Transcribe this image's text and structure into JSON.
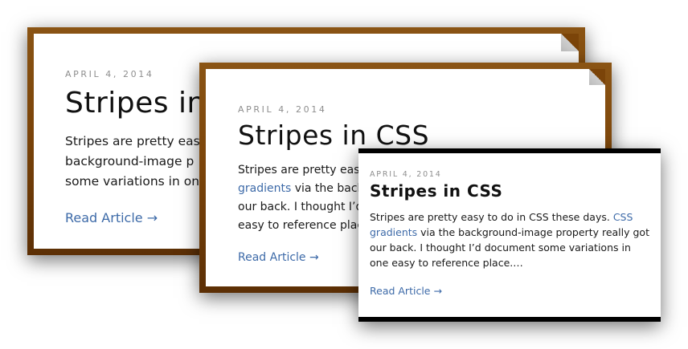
{
  "cards": [
    {
      "date": "APRIL 4, 2014",
      "title": "Stripes in",
      "excerpt_lines": [
        "Stripes are pretty eas",
        "background-image p",
        "some variations in on"
      ],
      "read_label": "Read Article →"
    },
    {
      "date": "APRIL 4, 2014",
      "title": "Stripes in CSS",
      "excerpt_line1": "Stripes are pretty eas",
      "excerpt_line2_link": "gradients",
      "excerpt_line2_rest": " via the back",
      "excerpt_line3": "our back. I thought I’d",
      "excerpt_line4": "easy to reference place",
      "read_label": "Read Article →"
    },
    {
      "date": "APRIL 4, 2014",
      "title": "Stripes in CSS",
      "excerpt_start": "Stripes are pretty easy to do in CSS these days. ",
      "excerpt_link": "CSS gradients",
      "excerpt_end": " via the background-image property really got our back. I thought I’d document some variations in one easy to reference place.…",
      "read_label": "Read Article →"
    }
  ],
  "colors": {
    "card_border_brown": "#7b4409",
    "card_border_black": "#000000",
    "link": "#3d6aa8",
    "date": "#8e8e8e",
    "title": "#111111"
  }
}
